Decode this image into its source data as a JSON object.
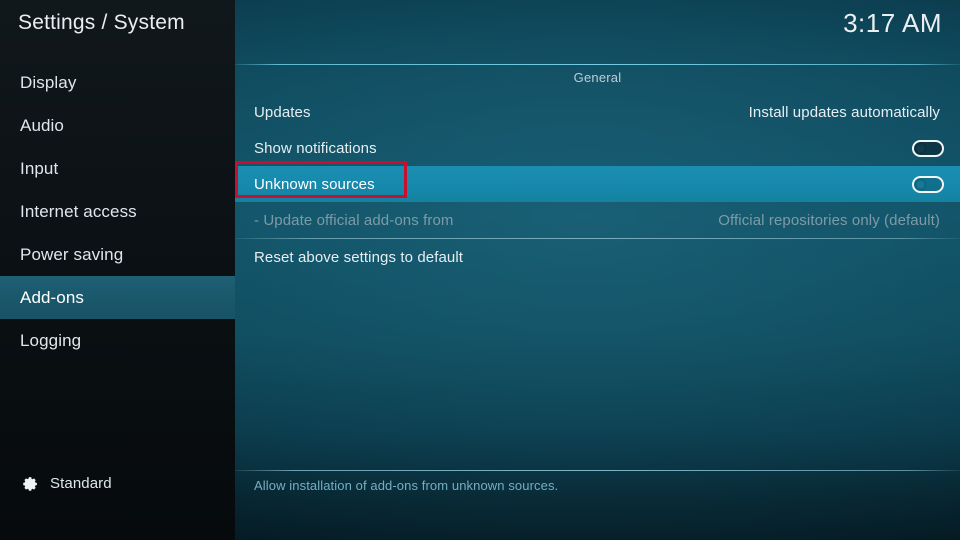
{
  "window": {
    "title": "Settings / System",
    "clock": "3:17 AM"
  },
  "sidebar": {
    "items": [
      {
        "label": "Display",
        "selected": false
      },
      {
        "label": "Audio",
        "selected": false
      },
      {
        "label": "Input",
        "selected": false
      },
      {
        "label": "Internet access",
        "selected": false
      },
      {
        "label": "Power saving",
        "selected": false
      },
      {
        "label": "Add-ons",
        "selected": true
      },
      {
        "label": "Logging",
        "selected": false
      }
    ],
    "profile": {
      "icon": "gear-icon",
      "label": "Standard"
    }
  },
  "main": {
    "section_title": "General",
    "rows": [
      {
        "label": "Updates",
        "value": "Install updates automatically",
        "control": "text",
        "state": "normal"
      },
      {
        "label": "Show notifications",
        "value": "",
        "control": "toggle",
        "toggle_on": false,
        "state": "normal"
      },
      {
        "label": "Unknown sources",
        "value": "",
        "control": "toggle",
        "toggle_on": false,
        "state": "highlight"
      },
      {
        "label": "- Update official add-ons from",
        "value": "Official repositories only (default)",
        "control": "text",
        "state": "disabled"
      },
      {
        "label": "Reset above settings to default",
        "value": "",
        "control": "none",
        "state": "normal"
      }
    ],
    "hint": "Allow installation of add-ons from unknown sources."
  },
  "annotation": {
    "target": "Unknown sources",
    "color": "#c8102e"
  },
  "colors": {
    "sidebar_bg": "#0c1216",
    "panel_top": "#0f4b5f",
    "row_highlight": "#1689ac",
    "sidebar_highlight": "#1a586c",
    "hint_text": "#74aec3",
    "annotation_red": "#c8102e"
  }
}
